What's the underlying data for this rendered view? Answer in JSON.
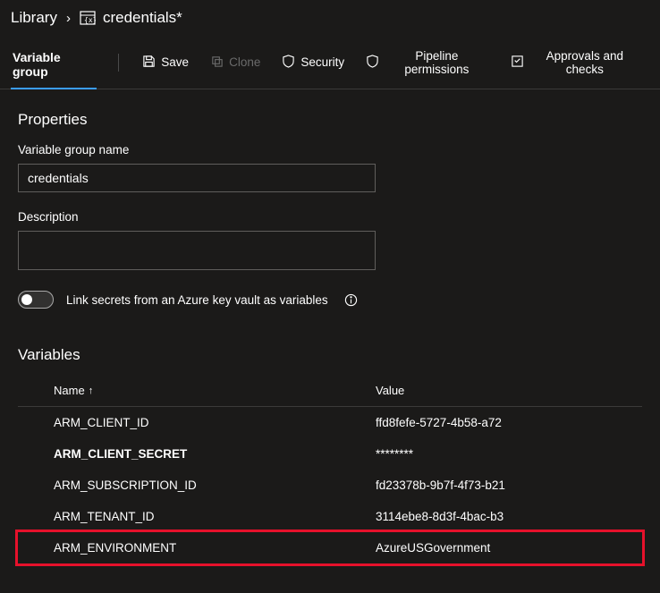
{
  "breadcrumb": {
    "library": "Library",
    "current": "credentials*"
  },
  "tab": {
    "label": "Variable group"
  },
  "toolbar": {
    "save": "Save",
    "clone": "Clone",
    "security": "Security",
    "pipeline_permissions": "Pipeline permissions",
    "approvals": "Approvals and checks"
  },
  "properties": {
    "title": "Properties",
    "name_label": "Variable group name",
    "name_value": "credentials",
    "description_label": "Description",
    "description_value": "",
    "link_secrets_label": "Link secrets from an Azure key vault as variables"
  },
  "variables": {
    "title": "Variables",
    "name_header": "Name",
    "value_header": "Value",
    "rows": [
      {
        "name": "ARM_CLIENT_ID",
        "value": "ffd8fefe-5727-4b58-a72"
      },
      {
        "name": "ARM_CLIENT_SECRET",
        "value": "********"
      },
      {
        "name": "ARM_SUBSCRIPTION_ID",
        "value": "fd23378b-9b7f-4f73-b21"
      },
      {
        "name": "ARM_TENANT_ID",
        "value": "3114ebe8-8d3f-4bac-b3"
      },
      {
        "name": "ARM_ENVIRONMENT",
        "value": "AzureUSGovernment"
      }
    ]
  }
}
